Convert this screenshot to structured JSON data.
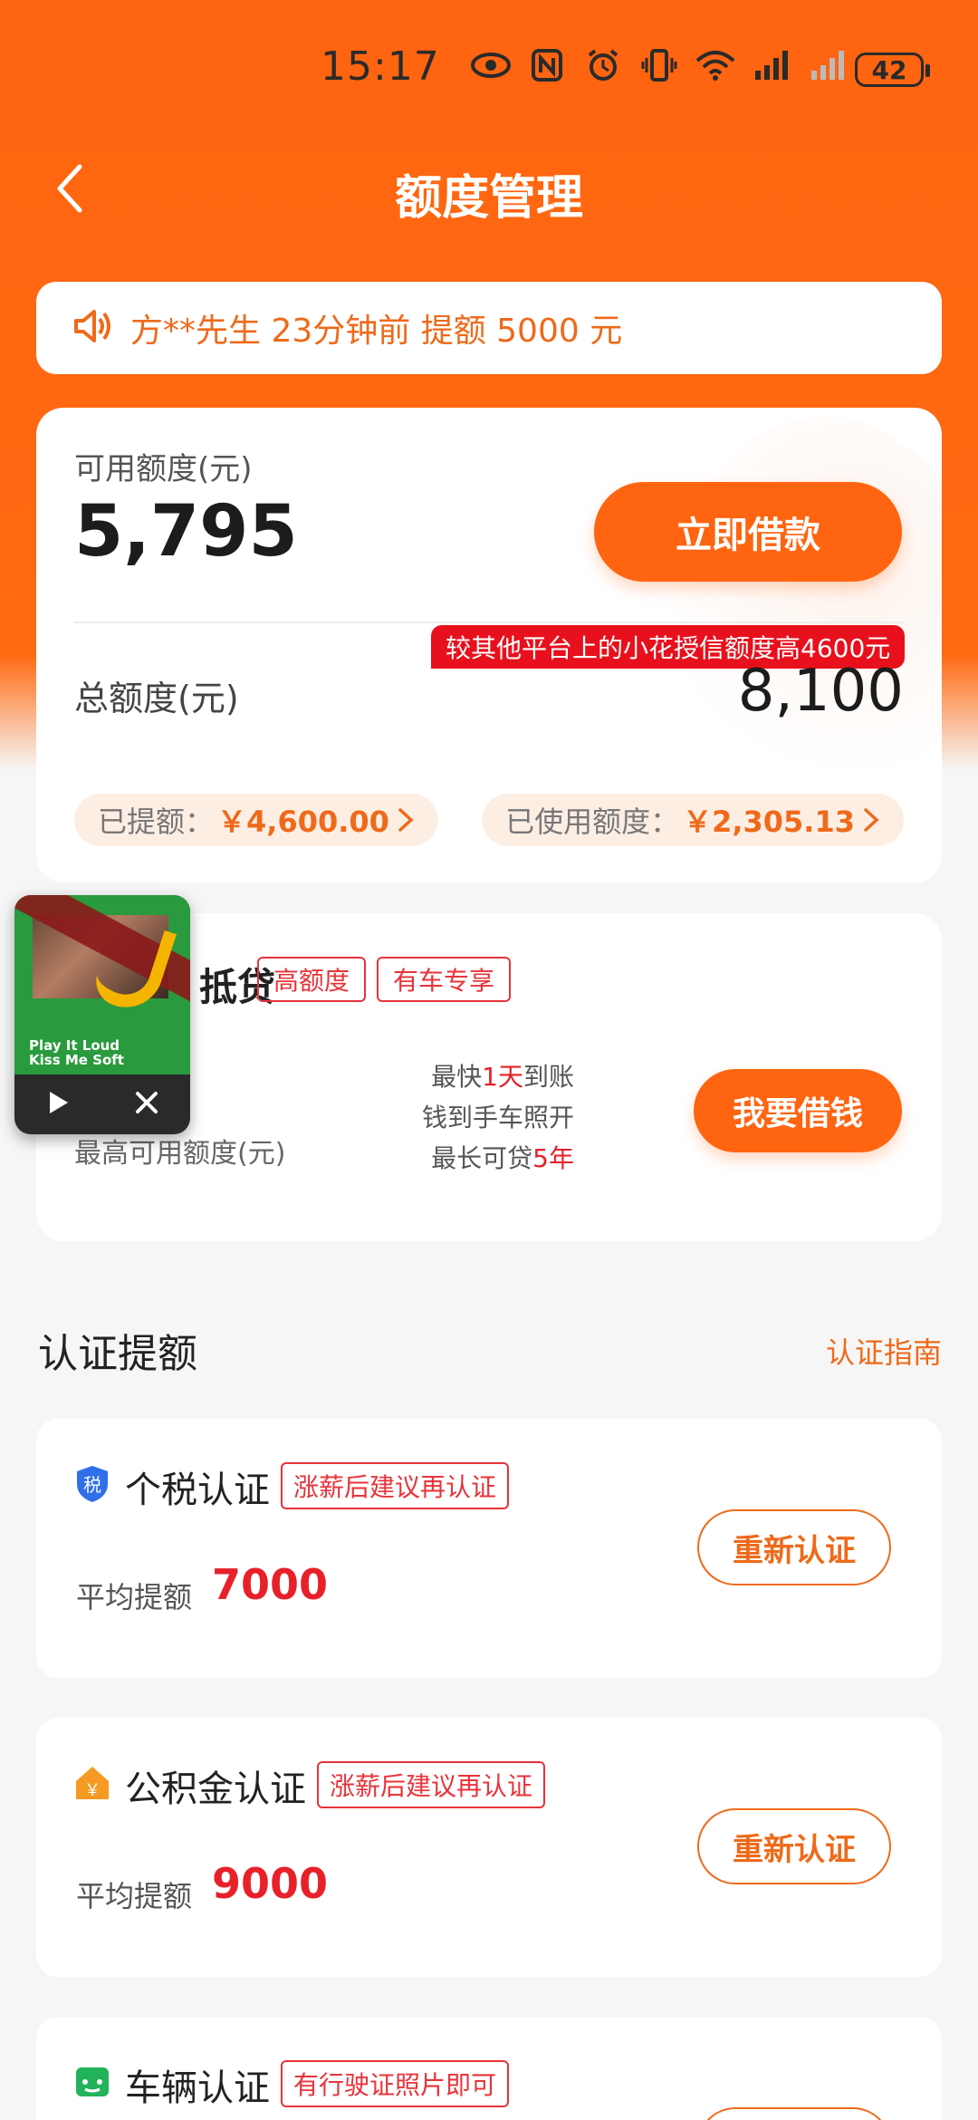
{
  "status_bar": {
    "time": "15:17",
    "battery": "42"
  },
  "header": {
    "title": "额度管理"
  },
  "notice": {
    "text": "方**先生 23分钟前 提额 5000 元"
  },
  "credit": {
    "available_label": "可用额度(元)",
    "available_value": "5,795",
    "borrow_button": "立即借款",
    "promo_badge": "较其他平台上的小花授信额度高4600元",
    "total_label": "总额度(元)",
    "total_value": "8,100",
    "withdrawn_label": "已提额：",
    "withdrawn_value": "￥4,600.00",
    "used_label": "已使用额度：",
    "used_value": "￥2,305.13"
  },
  "loan": {
    "title": "抵贷",
    "tags": [
      "高额度",
      "有车专享"
    ],
    "limit_label": "最高可用额度(元)",
    "features": [
      {
        "pre": "最快",
        "hl": "1天",
        "post": "到账"
      },
      {
        "pre": "钱到手车照开",
        "hl": "",
        "post": ""
      },
      {
        "pre": "最长可贷",
        "hl": "5年",
        "post": ""
      }
    ],
    "button": "我要借钱"
  },
  "mini_player": {
    "album_text_line1": "Play It Loud",
    "album_text_line2": "Kiss Me   Soft"
  },
  "verify_section": {
    "title": "认证提额",
    "guide_link": "认证指南"
  },
  "verify_items": [
    {
      "title": "个税认证",
      "tag": "涨薪后建议再认证",
      "avg_label": "平均提额",
      "avg_value": "7000",
      "button": "重新认证",
      "icon": "tax-shield-icon",
      "icon_char": "税"
    },
    {
      "title": "公积金认证",
      "tag": "涨薪后建议再认证",
      "avg_label": "平均提额",
      "avg_value": "9000",
      "button": "重新认证",
      "icon": "house-fund-icon",
      "icon_char": "￥"
    },
    {
      "title": "车辆认证",
      "tag": "有行驶证照片即可",
      "icon": "car-icon"
    }
  ],
  "colors": {
    "brand": "#ff6410",
    "accent_red": "#e8202a",
    "tag_red": "#e8333a",
    "link_orange": "#ee6a1a"
  }
}
